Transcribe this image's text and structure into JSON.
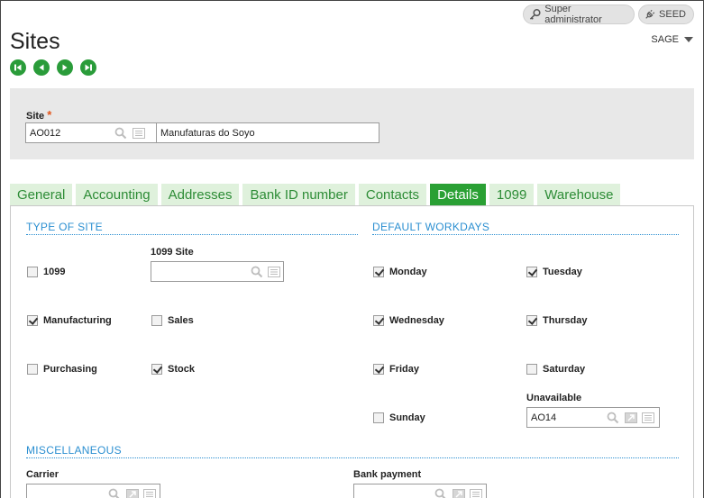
{
  "header": {
    "user_label": "Super administrator",
    "folder_pill": "SEED",
    "page_title": "Sites",
    "folder_selector": "SAGE"
  },
  "key": {
    "site_label": "Site",
    "required_mark": "*",
    "site_code": "AO012",
    "site_name": "Manufaturas do Soyo"
  },
  "tabs": [
    {
      "label": "General"
    },
    {
      "label": "Accounting"
    },
    {
      "label": "Addresses"
    },
    {
      "label": "Bank ID number"
    },
    {
      "label": "Contacts"
    },
    {
      "label": "Details",
      "active": true
    },
    {
      "label": "1099"
    },
    {
      "label": "Warehouse"
    }
  ],
  "type_of_site": {
    "title": "TYPE OF SITE",
    "site_1099_label": "1099 Site",
    "site_1099_value": "",
    "checkboxes": [
      {
        "label": "1099",
        "checked": false
      },
      {
        "label": "Manufacturing",
        "checked": true
      },
      {
        "label": "Sales",
        "checked": false
      },
      {
        "label": "Purchasing",
        "checked": false
      },
      {
        "label": "Stock",
        "checked": true
      }
    ]
  },
  "workdays": {
    "title": "DEFAULT WORKDAYS",
    "days": [
      {
        "label": "Monday",
        "checked": true
      },
      {
        "label": "Tuesday",
        "checked": true
      },
      {
        "label": "Wednesday",
        "checked": true
      },
      {
        "label": "Thursday",
        "checked": true
      },
      {
        "label": "Friday",
        "checked": true
      },
      {
        "label": "Saturday",
        "checked": false
      },
      {
        "label": "Sunday",
        "checked": false
      }
    ],
    "unavailable_label": "Unavailable",
    "unavailable_value": "AO14"
  },
  "misc": {
    "title": "MISCELLANEOUS",
    "carrier_label": "Carrier",
    "carrier_value": "",
    "bank_payment_label": "Bank payment",
    "bank_payment_value": ""
  },
  "colors": {
    "accent_green": "#2aa034",
    "tab_inactive_bg": "#dff1dc",
    "section_blue": "#2b8fd1",
    "required_orange": "#e2551b"
  }
}
